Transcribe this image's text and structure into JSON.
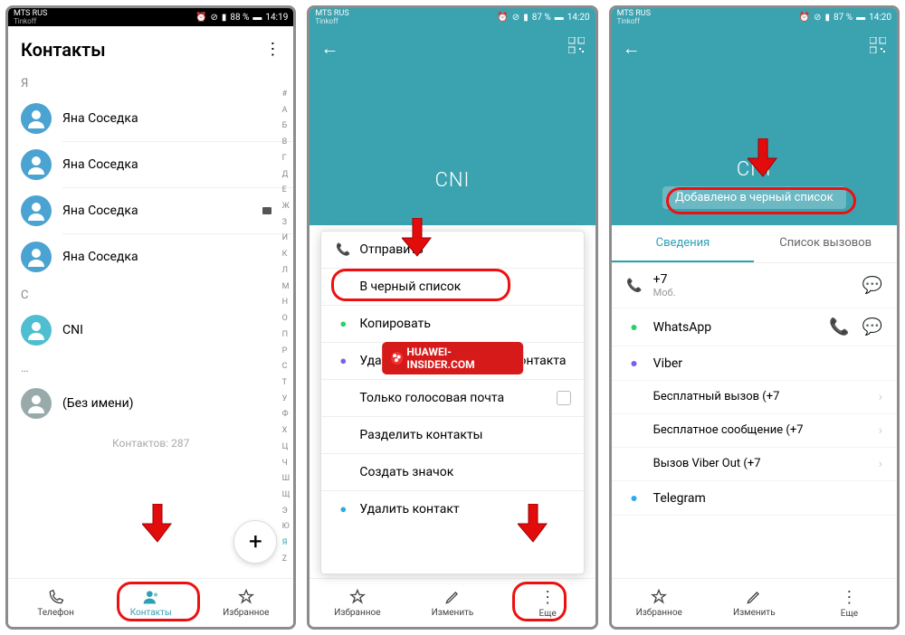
{
  "statusbar": {
    "carrier": "MTS RUS",
    "subcarrier": "Tinkoff",
    "battery1": "88 %",
    "battery2": "87 %",
    "time1": "14:19",
    "time2": "14:20"
  },
  "screen1": {
    "title": "Контакты",
    "sections": {
      "ya": "Я",
      "c": "C",
      "dots": "…"
    },
    "contacts_ya": [
      "Яна Соседка",
      "Яна Соседка",
      "Яна Соседка",
      "Яна Соседка"
    ],
    "contact_c": "CNI",
    "contact_noname": "(Без имени)",
    "count": "Контактов: 287",
    "alpha": [
      "#",
      "A",
      "Б",
      "В",
      "Г",
      "Д",
      "Е",
      "Ж",
      "З",
      "И",
      "К",
      "Л",
      "М",
      "Н",
      "О",
      "П",
      "Р",
      "С",
      "Т",
      "У",
      "Ф",
      "Х",
      "Ц",
      "Ч",
      "Ш",
      "Щ",
      "Э",
      "Ю",
      "Я",
      "Z"
    ],
    "bottom": {
      "phone": "Телефон",
      "contacts": "Контакты",
      "fav": "Избранное"
    }
  },
  "screen2": {
    "hero_title": "CNI",
    "menu": {
      "send": "Отправить",
      "blacklist": "В черный список",
      "copy": "Копировать",
      "delete_mentions": "Удалить все упоминания контакта",
      "voicemail": "Только голосовая почта",
      "split": "Разделить контакты",
      "shortcut": "Создать значок",
      "delete": "Удалить контакт"
    },
    "bottom": {
      "fav": "Избранное",
      "edit": "Изменить",
      "more": "Еще"
    }
  },
  "screen3": {
    "hero_title": "CNI",
    "toast": "Добавлено в черный список",
    "tabs": {
      "info": "Сведения",
      "calls": "Список вызовов"
    },
    "phone_row": {
      "num": "+7",
      "type": "Моб."
    },
    "wa": "WhatsApp",
    "viber": "Viber",
    "viber_sub": {
      "freecall": "Бесплатный вызов (+7",
      "freemsg": "Бесплатное сообщение (+7",
      "viberout": "Вызов Viber Out (+7"
    },
    "tg": "Telegram",
    "bottom": {
      "fav": "Избранное",
      "edit": "Изменить",
      "more": "Еще"
    }
  },
  "watermark": "HUAWEI-INSIDER.COM"
}
